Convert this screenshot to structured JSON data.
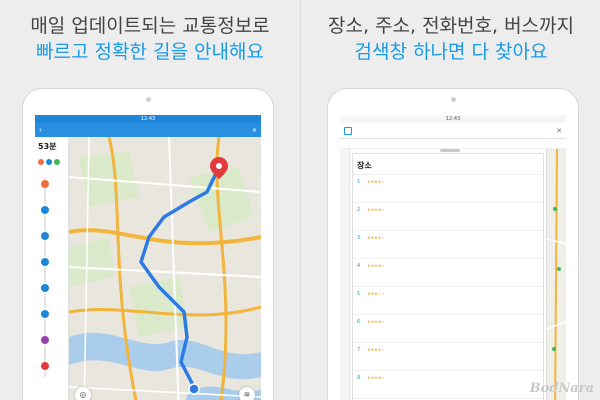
{
  "left_panel": {
    "headline_line1": "매일 업데이트되는 교통정보로",
    "headline_line2": "빠르고 정확한 길을 안내해요",
    "screen": {
      "status_time": "12:43",
      "route_title": "",
      "route_summary": {
        "duration": "53분",
        "meta": ""
      },
      "stop_colors": [
        "#f26d3d",
        "#1e86d9",
        "#1e86d9",
        "#1e86d9",
        "#1e86d9",
        "#1e86d9",
        "#9a3fb0",
        "#e23b3b"
      ],
      "transport_colors": [
        "#f26d3d",
        "#1e86d9",
        "#3dbb5a"
      ],
      "map_icons": [
        "current-location-icon",
        "layers-icon"
      ]
    }
  },
  "right_panel": {
    "headline_line1": "장소, 주소, 전화번호, 버스까지",
    "headline_line2": "검색창 하나면 다 찾아요",
    "screen": {
      "status_time": "12:43",
      "query": "",
      "filters": [
        "",
        ""
      ],
      "list_header": "",
      "category": "장소",
      "results": [
        {
          "num": "1",
          "name": "",
          "addr": "",
          "stars": "★★★★☆"
        },
        {
          "num": "2",
          "name": "",
          "addr": "",
          "stars": "★★★★☆"
        },
        {
          "num": "3",
          "name": "",
          "addr": "",
          "stars": "★★★★☆"
        },
        {
          "num": "4",
          "name": "",
          "addr": "",
          "stars": "★★★★☆"
        },
        {
          "num": "5",
          "name": "",
          "addr": "",
          "stars": "★★★☆☆"
        },
        {
          "num": "6",
          "name": "",
          "addr": "",
          "stars": "★★★★☆"
        },
        {
          "num": "7",
          "name": "",
          "addr": "",
          "stars": "★★★★☆"
        },
        {
          "num": "8",
          "name": "",
          "addr": "",
          "stars": "★★★★☆"
        }
      ]
    }
  },
  "watermark": "BodNara",
  "colors": {
    "accent": "#1a9be6",
    "headline": "#444444",
    "route": "#2c7be5",
    "highway": "#f2b43a"
  }
}
